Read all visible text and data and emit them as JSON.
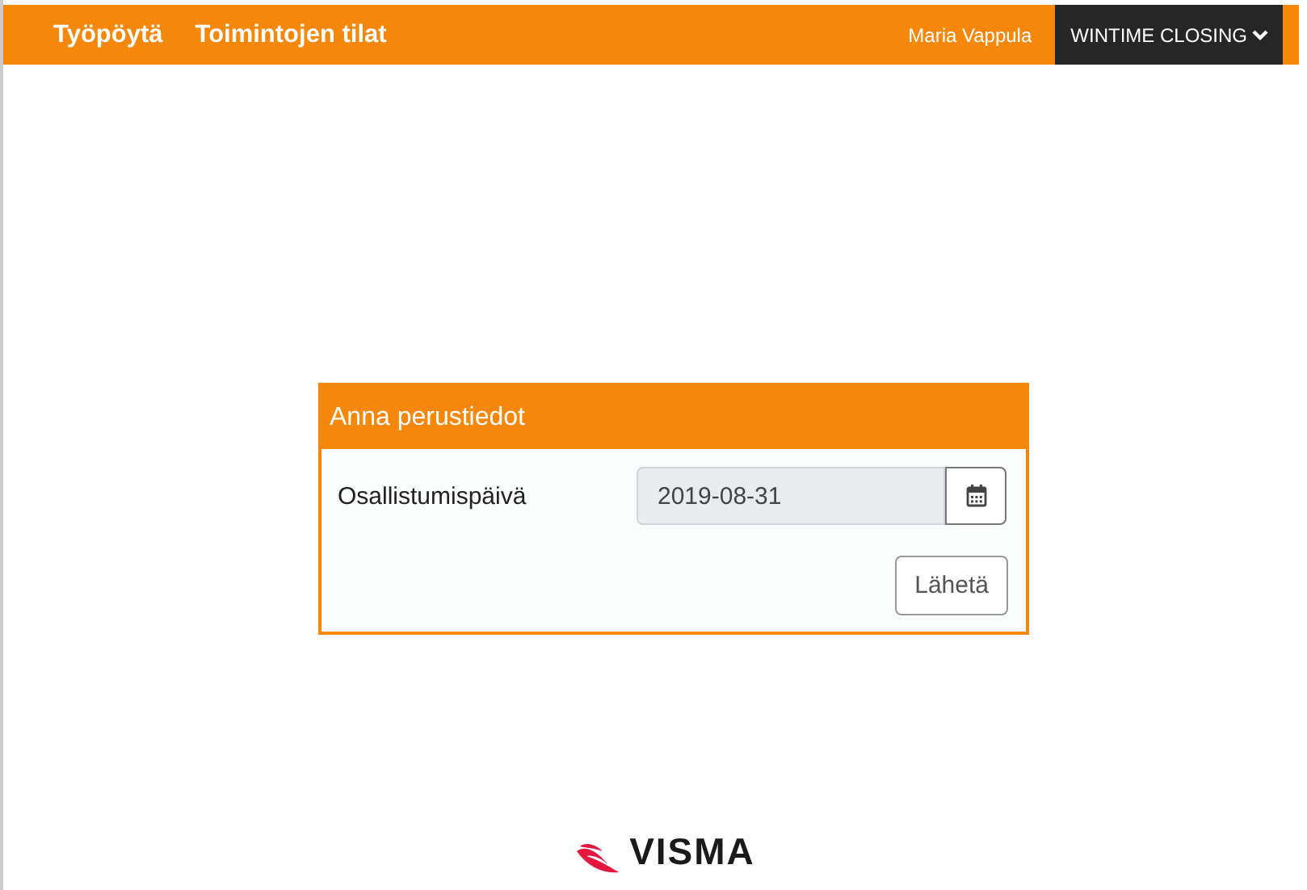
{
  "nav": {
    "links": [
      "Työpöytä",
      "Toimintojen tilat"
    ],
    "user": "Maria Vappula",
    "menu": {
      "label": "WINTIME CLOSING"
    }
  },
  "dialog": {
    "title": "Anna perustiedot",
    "field": {
      "label": "Osallistumispäivä",
      "value": "2019-08-31",
      "disabled": true
    },
    "submit": "Lähetä"
  },
  "footer": {
    "logo": "VISMA"
  }
}
